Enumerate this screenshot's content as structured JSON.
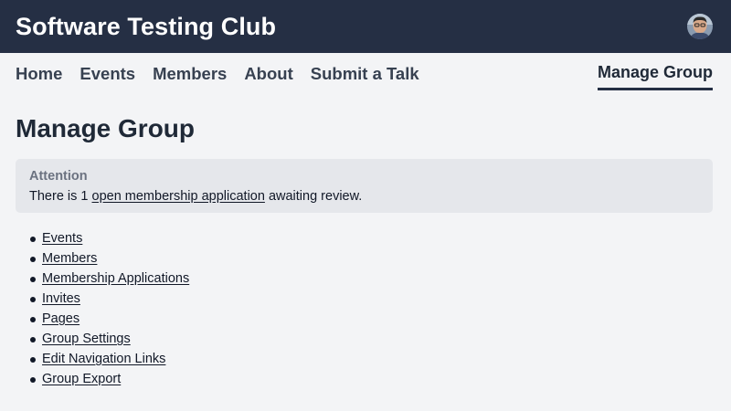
{
  "header": {
    "site_title": "Software Testing Club",
    "avatar_icon": "user-avatar-photo"
  },
  "nav": {
    "items": [
      {
        "label": "Home"
      },
      {
        "label": "Events"
      },
      {
        "label": "Members"
      },
      {
        "label": "About"
      },
      {
        "label": "Submit a Talk"
      }
    ],
    "active_label": "Manage Group"
  },
  "main": {
    "title": "Manage Group",
    "alert": {
      "heading": "Attention",
      "text_before": "There is 1 ",
      "link_text": "open membership application",
      "text_after": " awaiting review."
    },
    "menu": [
      {
        "label": "Events"
      },
      {
        "label": "Members"
      },
      {
        "label": "Membership Applications"
      },
      {
        "label": "Invites"
      },
      {
        "label": "Pages"
      },
      {
        "label": "Group Settings"
      },
      {
        "label": "Edit Navigation Links"
      },
      {
        "label": "Group Export"
      }
    ]
  },
  "colors": {
    "header_bg": "#252f44",
    "page_bg": "#f3f4f6",
    "alert_bg": "#e5e7eb"
  }
}
